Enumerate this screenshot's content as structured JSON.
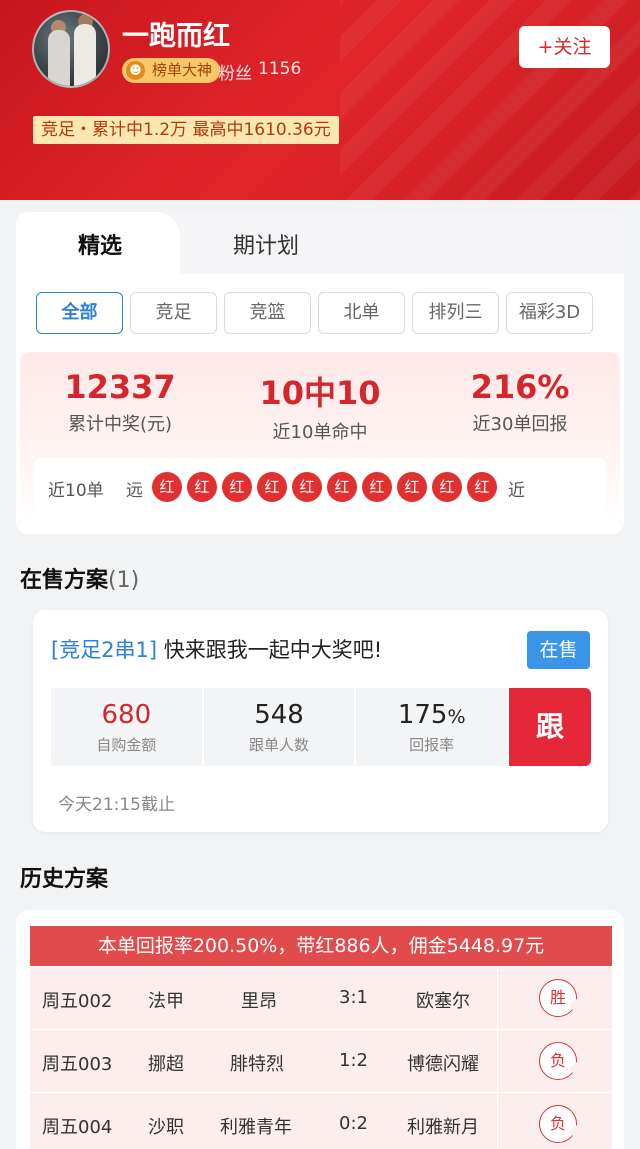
{
  "profile": {
    "name": "一跑而红",
    "badge": "榜单大神",
    "fans_label": "粉丝",
    "fans_count": "1156",
    "follow_label": "+关注",
    "record": "竞足・累计中1.2万 最高中1610.36元"
  },
  "tabs": [
    {
      "label": "精选",
      "active": true
    },
    {
      "label": "期计划",
      "active": false
    }
  ],
  "filters": [
    {
      "label": "全部",
      "active": true
    },
    {
      "label": "竞足"
    },
    {
      "label": "竞篮"
    },
    {
      "label": "北单"
    },
    {
      "label": "排列三"
    },
    {
      "label": "福彩3D"
    }
  ],
  "stats": [
    {
      "value": "12337",
      "label": "累计中奖(元)"
    },
    {
      "value": "10中10",
      "label": "近10单命中"
    },
    {
      "value": "216%",
      "label": "近30单回报"
    }
  ],
  "recent": {
    "label": "近10单",
    "far": "远",
    "near": "近",
    "results": [
      "红",
      "红",
      "红",
      "红",
      "红",
      "红",
      "红",
      "红",
      "红",
      "红"
    ]
  },
  "on_sale": {
    "title": "在售方案",
    "count": "(1)",
    "plan": {
      "tag": "[竞足2串1]",
      "text": " 快来跟我一起中大奖吧!",
      "status": "在售",
      "metrics": [
        {
          "value": "680",
          "label": "自购金额"
        },
        {
          "value": "548",
          "label": "跟单人数"
        },
        {
          "value": "175",
          "unit": "%",
          "label": "回报率"
        }
      ],
      "follow_label": "跟",
      "deadline": "今天21:15截止"
    }
  },
  "history": {
    "title": "历史方案",
    "banner": "本单回报率200.50%，带红886人，佣金5448.97元",
    "rows": [
      {
        "match_id": "周五002",
        "league": "法甲",
        "home": "里昂",
        "score": "3:1",
        "away": "欧塞尔",
        "result": "胜"
      },
      {
        "match_id": "周五003",
        "league": "挪超",
        "home": "腓特烈",
        "score": "1:2",
        "away": "博德闪耀",
        "result": "负"
      },
      {
        "match_id": "周五004",
        "league": "沙职",
        "home": "利雅青年",
        "score": "0:2",
        "away": "利雅新月",
        "result": "负"
      }
    ]
  },
  "colors": {
    "brand_red": "#d6262d",
    "accent_blue": "#2e7fd9",
    "header_red": "#c8161d"
  }
}
